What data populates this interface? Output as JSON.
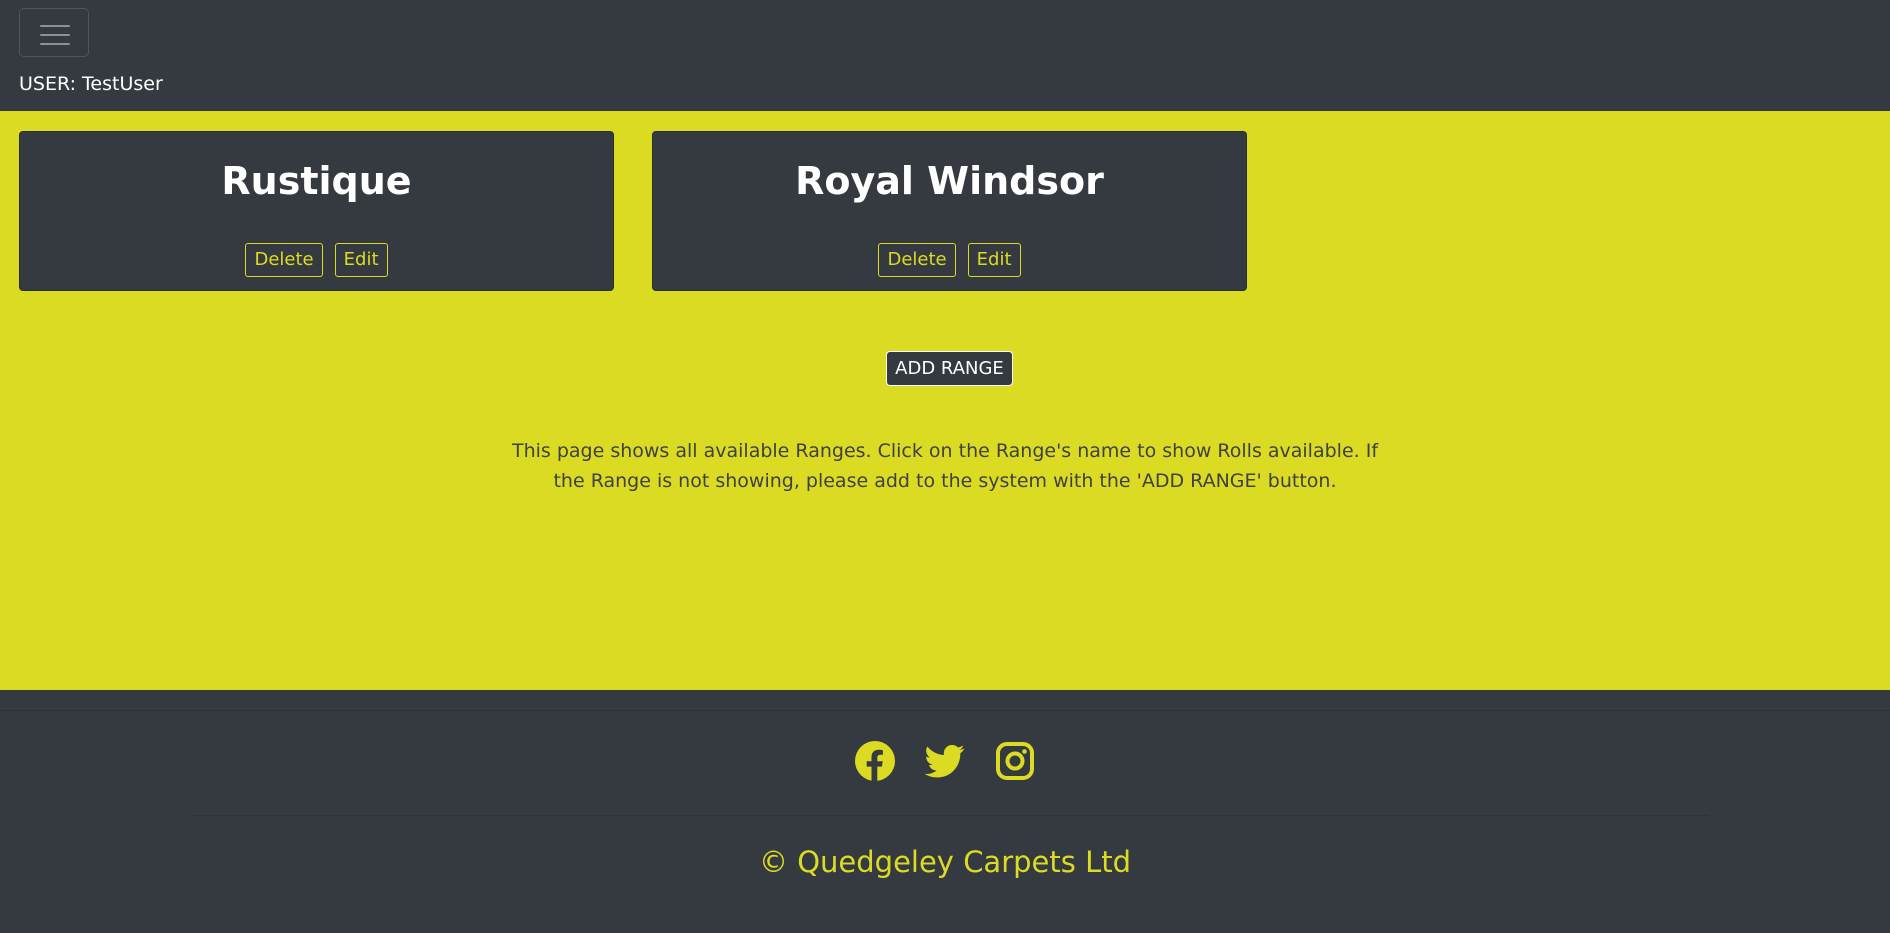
{
  "header": {
    "menu_icon": "hamburger-menu-icon",
    "user_label": "USER: TestUser"
  },
  "ranges": [
    {
      "name": "Rustique",
      "delete_label": "Delete",
      "edit_label": "Edit"
    },
    {
      "name": "Royal Windsor",
      "delete_label": "Delete",
      "edit_label": "Edit"
    }
  ],
  "actions": {
    "add_range_label": "ADD RANGE"
  },
  "info_text": "This page shows all available Ranges. Click on the Range's name to show Rolls available. If the Range is not showing, please add to the system with the 'ADD RANGE' button.",
  "footer": {
    "social_icons": [
      "facebook-icon",
      "twitter-icon",
      "instagram-icon"
    ],
    "copyright": "© Quedgeley Carpets Ltd"
  },
  "colors": {
    "accent": "#dcdb24",
    "dark": "#343a40",
    "text_on_accent": "#3f4146"
  }
}
